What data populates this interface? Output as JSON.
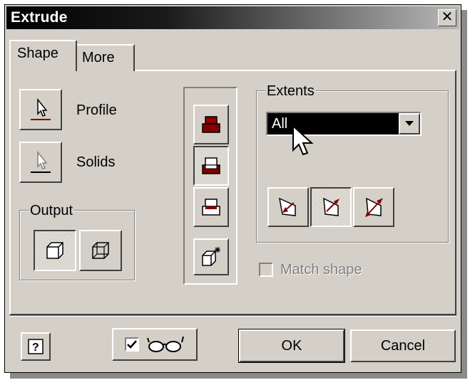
{
  "dialog": {
    "title": "Extrude",
    "close_glyph": "✕"
  },
  "tabs": [
    {
      "label": "Shape",
      "active": true
    },
    {
      "label": "More",
      "active": false
    }
  ],
  "left": {
    "profile_label": "Profile",
    "solids_label": "Solids",
    "output_label": "Output"
  },
  "extents": {
    "label": "Extents",
    "value": "All",
    "options_visible": [
      "All"
    ]
  },
  "match_shape": {
    "label": "Match shape",
    "checked": false,
    "enabled": false
  },
  "footer": {
    "ok_label": "OK",
    "cancel_label": "Cancel",
    "help_glyph": "?",
    "preview_checked": true
  },
  "icons": {
    "profile": "arrow-cursor-icon",
    "solids": "arrow-cursor-icon",
    "output_solid": "solid-cube-icon",
    "output_surface": "surface-cube-icon",
    "operation_join": "join-icon",
    "operation_cut": "cut-icon",
    "operation_intersect": "intersect-icon",
    "new_solid": "new-solid-icon",
    "direction_1": "direction-1-icon",
    "direction_2": "direction-2-icon",
    "direction_symmetric": "direction-symmetric-icon",
    "preview": "glasses-icon",
    "help": "help-icon",
    "mouse_cursor": "mouse-pointer-icon"
  }
}
